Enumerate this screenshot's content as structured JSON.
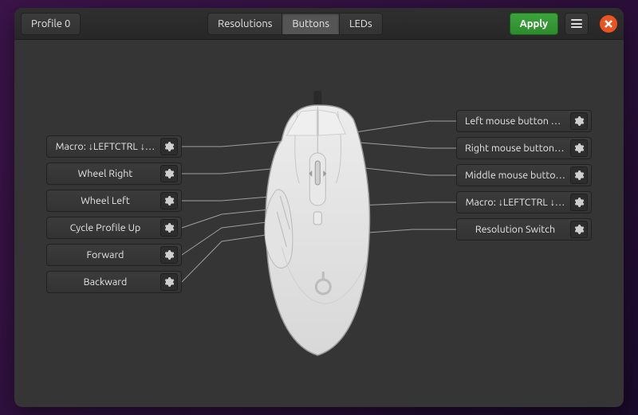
{
  "header": {
    "profile_label": "Profile 0",
    "tabs": {
      "resolutions": "Resolutions",
      "buttons": "Buttons",
      "leds": "LEDs"
    },
    "active_tab": "buttons",
    "apply_label": "Apply"
  },
  "left_panel": [
    {
      "id": "macro-left",
      "label": "Macro: ↓LEFTCTRL ↓…"
    },
    {
      "id": "wheel-right",
      "label": "Wheel Right"
    },
    {
      "id": "wheel-left",
      "label": "Wheel Left"
    },
    {
      "id": "cycle-profile",
      "label": "Cycle Profile Up"
    },
    {
      "id": "forward",
      "label": "Forward"
    },
    {
      "id": "backward",
      "label": "Backward"
    }
  ],
  "right_panel": [
    {
      "id": "left-click",
      "label": "Left mouse button cli…"
    },
    {
      "id": "right-click",
      "label": "Right mouse button …"
    },
    {
      "id": "middle-click",
      "label": "Middle mouse butto…"
    },
    {
      "id": "macro-right",
      "label": "Macro: ↓LEFTCTRL ↓…"
    },
    {
      "id": "res-switch",
      "label": "Resolution Switch"
    }
  ],
  "colors": {
    "accent": "#e95420",
    "apply": "#3ca43c"
  }
}
